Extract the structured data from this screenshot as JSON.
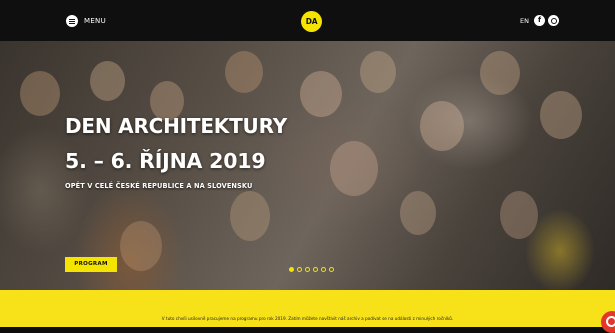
{
  "header": {
    "menu_label": "MENU",
    "logo_text": "DA",
    "lang_label": "EN",
    "social": [
      {
        "icon": "facebook-icon",
        "glyph": "f"
      },
      {
        "icon": "instagram-icon"
      }
    ]
  },
  "hero": {
    "title_line1": "DEN ARCHITEKTURY",
    "title_line2": "5. – 6. ŘÍJNA 2019",
    "subtitle": "OPĚT V CELÉ ČESKÉ REPUBLICE A NA SLOVENSKU",
    "program_button": "PROGRAM",
    "slides_total": 6,
    "slide_active": 1
  },
  "notice": {
    "text": "V tuto chvíli usilovně pracujeme na programu pro rok 2019. Zatím můžete navštívit náš archiv a podívat se na události z minulých ročníků."
  },
  "colors": {
    "accent": "#f5e400",
    "notice_bg": "#f7e21a",
    "header_bg": "#0f0f0f",
    "chat": "#e3372a"
  }
}
